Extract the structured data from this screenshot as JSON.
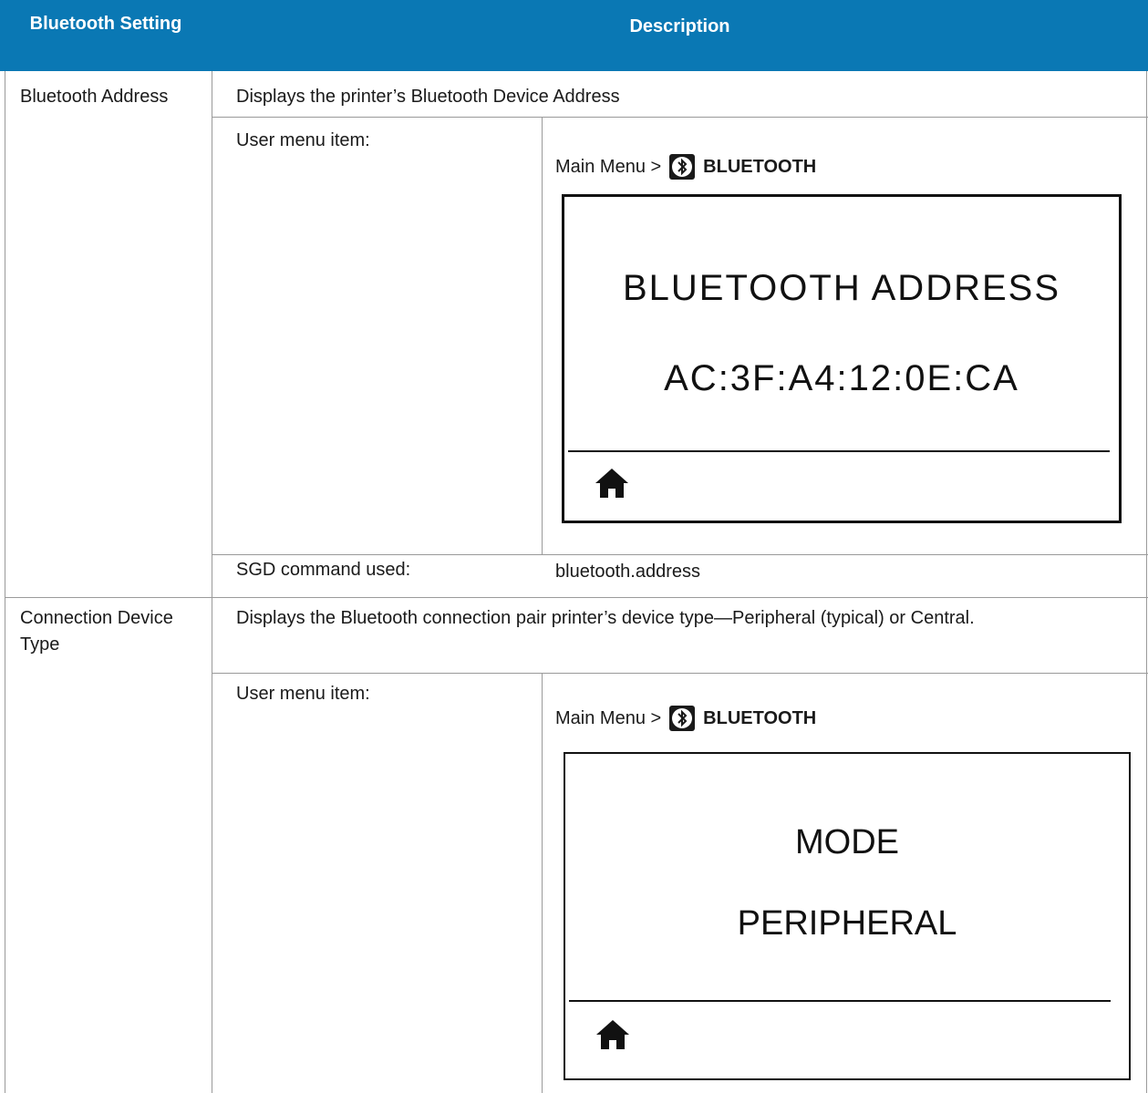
{
  "table": {
    "headers": {
      "setting": "Bluetooth Setting",
      "description": "Description"
    },
    "rows": [
      {
        "setting": "Bluetooth Address",
        "description": "Displays the printer’s Bluetooth Device Address",
        "user_menu_label": "User menu item:",
        "menu_path_prefix": "Main Menu >",
        "menu_path_item": "BLUETOOTH",
        "screen_line1": "BLUETOOTH ADDRESS",
        "screen_line2": "AC:3F:A4:12:0E:CA",
        "sgd_label": "SGD command used:",
        "sgd_value": "bluetooth.address"
      },
      {
        "setting": "Connection Device Type",
        "description": "Displays the Bluetooth connection pair printer’s device type—Peripheral (typical) or Central.",
        "user_menu_label": "User menu item:",
        "menu_path_prefix": "Main Menu >",
        "menu_path_item": "BLUETOOTH",
        "screen_line1": "MODE",
        "screen_line2": "PERIPHERAL"
      }
    ]
  },
  "icons": {
    "bluetooth": "bluetooth-icon",
    "home": "home-icon"
  },
  "colors": {
    "header_bg": "#0a78b4",
    "header_text": "#ffffff",
    "grid": "#9a9a9a"
  }
}
